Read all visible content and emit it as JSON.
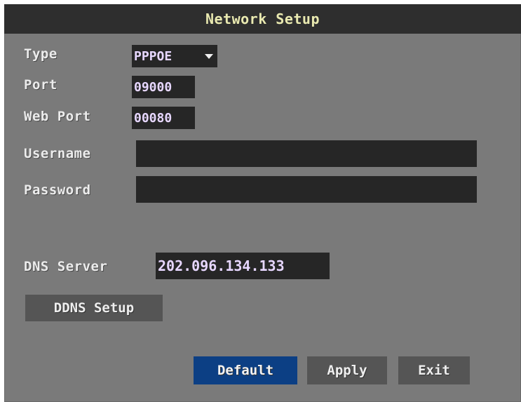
{
  "window": {
    "title": "Network Setup"
  },
  "form": {
    "type_label": "Type",
    "type_value": "PPPOE",
    "port_label": "Port",
    "port_value": "09000",
    "web_port_label": "Web Port",
    "web_port_value": "00080",
    "username_label": "Username",
    "username_value": "",
    "password_label": "Password",
    "password_value": "",
    "dns_label": "DNS Server",
    "dns_value": "202.096.134.133"
  },
  "buttons": {
    "ddns_label": "DDNS Setup",
    "default_label": "Default",
    "apply_label": "Apply",
    "exit_label": "Exit"
  },
  "colors": {
    "panel": "#7a7a7a",
    "title_bar": "#2e2e2e",
    "field": "#262626",
    "primary_button": "#0c3f84",
    "button": "#555555"
  },
  "icons": {
    "type_dropdown": "chevron-down-icon"
  }
}
